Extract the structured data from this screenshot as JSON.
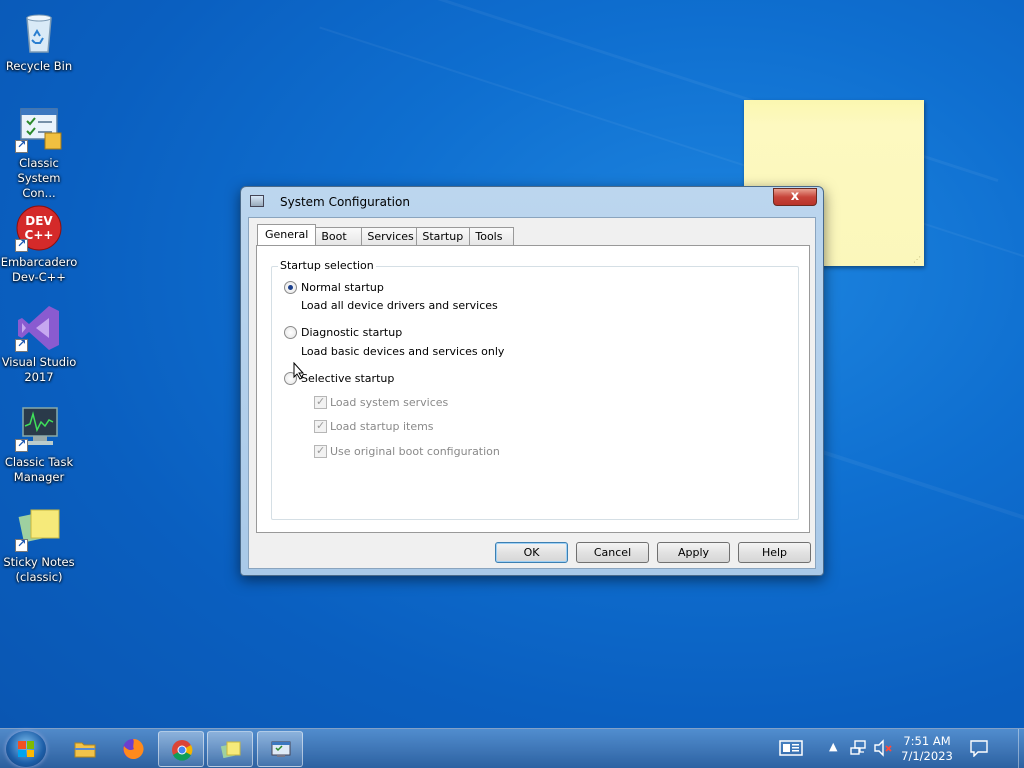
{
  "desktop": {
    "icons": [
      {
        "label": "Recycle Bin",
        "icon": "recycle-bin-icon"
      },
      {
        "label": "Classic System Con...",
        "icon": "system-control-icon"
      },
      {
        "label": "Embarcadero Dev-C++",
        "icon": "dev-cpp-icon",
        "badge": "DEV C++"
      },
      {
        "label": "Visual Studio 2017",
        "icon": "visual-studio-icon"
      },
      {
        "label": "Classic Task Manager",
        "icon": "task-manager-icon"
      },
      {
        "label": "Sticky Notes (classic)",
        "icon": "sticky-notes-icon"
      }
    ]
  },
  "dialog": {
    "title": "System Configuration",
    "close_glyph": "x",
    "tabs": [
      "General",
      "Boot",
      "Services",
      "Startup",
      "Tools"
    ],
    "active_tab": "General",
    "group_label": "Startup selection",
    "options": [
      {
        "label": "Normal startup",
        "description": "Load all device drivers and services",
        "checked": true
      },
      {
        "label": "Diagnostic startup",
        "description": "Load basic devices and services only",
        "checked": false
      },
      {
        "label": "Selective startup",
        "description": "",
        "checked": false
      }
    ],
    "selective_items": [
      {
        "label": "Load system services",
        "checked": true,
        "enabled": false
      },
      {
        "label": "Load startup items",
        "checked": true,
        "enabled": false
      },
      {
        "label": "Use original boot configuration",
        "checked": true,
        "enabled": false
      }
    ],
    "buttons": {
      "ok": "OK",
      "cancel": "Cancel",
      "apply": "Apply",
      "help": "Help"
    }
  },
  "taskbar": {
    "pinned": [
      "file-explorer-icon",
      "firefox-icon",
      "chrome-icon",
      "sticky-notes-icon",
      "system-configuration-icon"
    ],
    "clock_time": "7:51 AM",
    "clock_date": "7/1/2023",
    "colors": {
      "accent": "#0f6fd0"
    }
  }
}
